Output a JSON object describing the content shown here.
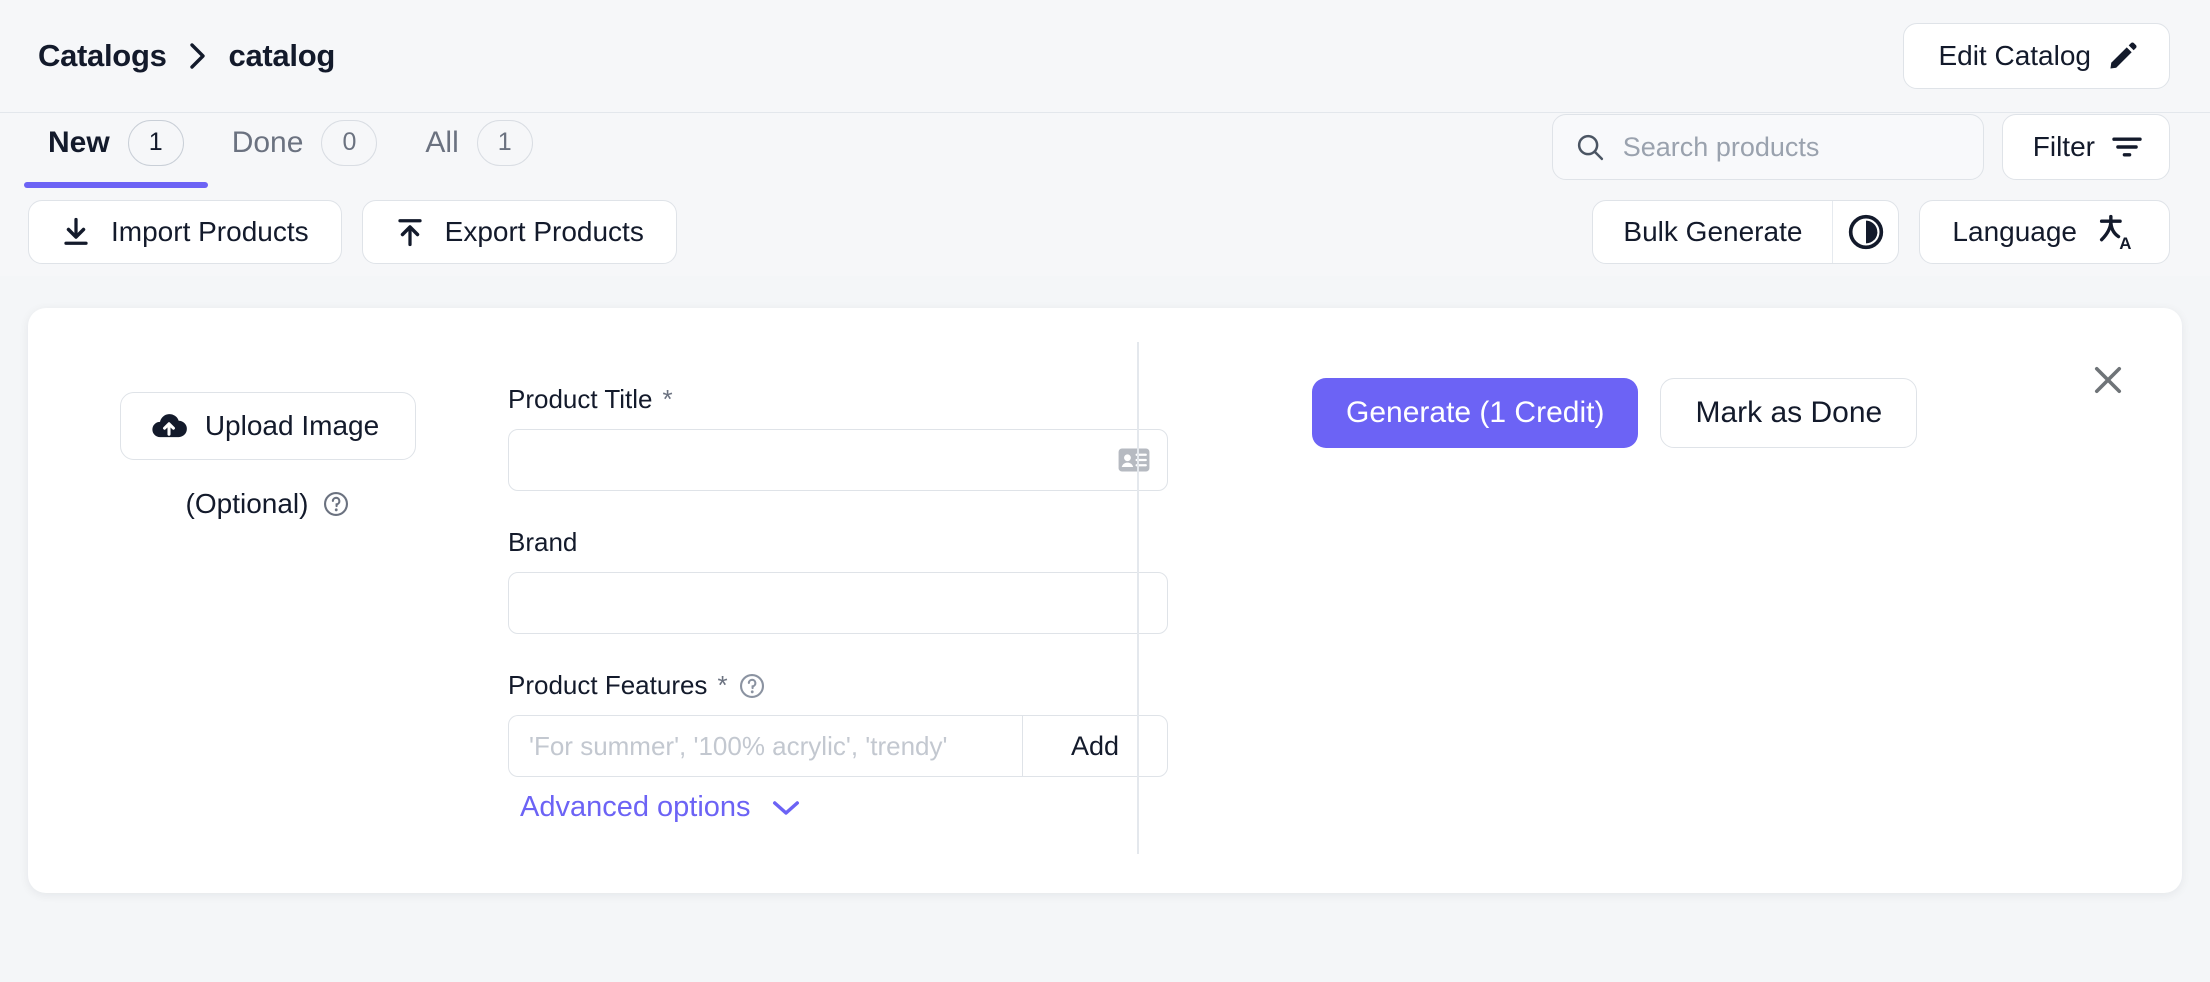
{
  "header": {
    "breadcrumb": {
      "root": "Catalogs",
      "current": "catalog",
      "separator_icon": "chevron-right-icon"
    },
    "edit_catalog_label": "Edit Catalog",
    "edit_catalog_icon": "pencil-icon"
  },
  "tabs": [
    {
      "label": "New",
      "count": "1",
      "active": true
    },
    {
      "label": "Done",
      "count": "0",
      "active": false
    },
    {
      "label": "All",
      "count": "1",
      "active": false
    }
  ],
  "search": {
    "value": "",
    "placeholder": "Search products",
    "icon": "search-icon"
  },
  "filter": {
    "label": "Filter",
    "icon": "filter-icon"
  },
  "toolbar": {
    "import_label": "Import Products",
    "import_icon": "download-icon",
    "export_label": "Export Products",
    "export_icon": "upload-icon",
    "bulk_generate_label": "Bulk Generate",
    "bulk_generate_icon": "contrast-circle-icon",
    "language_label": "Language",
    "language_icon": "translate-icon"
  },
  "product_card": {
    "upload": {
      "button_label": "Upload Image",
      "button_icon": "cloud-upload-icon",
      "optional_label": "(Optional)",
      "help_icon": "help-circle-icon"
    },
    "fields": {
      "product_title": {
        "label": "Product Title",
        "required_marker": "*",
        "value": "",
        "placeholder": "",
        "trailing_icon": "contact-card-icon"
      },
      "brand": {
        "label": "Brand",
        "required_marker": "",
        "value": "",
        "placeholder": ""
      },
      "product_features": {
        "label": "Product Features",
        "required_marker": "*",
        "help_icon": "help-circle-icon",
        "value": "",
        "placeholder": "'For summer', '100% acrylic', 'trendy'",
        "add_label": "Add"
      }
    },
    "advanced_options": {
      "label": "Advanced options",
      "icon": "chevron-down-icon"
    },
    "actions": {
      "generate_label": "Generate (1 Credit)",
      "mark_done_label": "Mark as Done",
      "close_icon": "close-icon"
    }
  },
  "colors": {
    "accent": "#6c63f5",
    "page_background": "#f4f6f8",
    "card_background": "#ffffff",
    "text": "#131a2b",
    "muted_text": "#6b7280",
    "border": "#dfe3e8"
  }
}
